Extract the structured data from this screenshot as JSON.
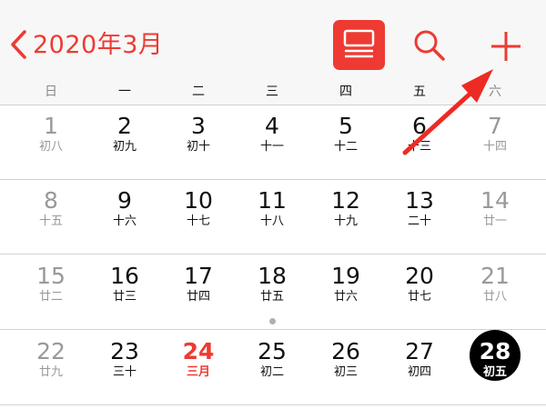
{
  "header": {
    "title": "2020年3月",
    "accent": "#ee3a32"
  },
  "weekdays": [
    "日",
    "一",
    "二",
    "三",
    "四",
    "五",
    "六"
  ],
  "weeks": [
    [
      {
        "num": "1",
        "lunar": "初八"
      },
      {
        "num": "2",
        "lunar": "初九"
      },
      {
        "num": "3",
        "lunar": "初十"
      },
      {
        "num": "4",
        "lunar": "十一"
      },
      {
        "num": "5",
        "lunar": "十二"
      },
      {
        "num": "6",
        "lunar": "十三"
      },
      {
        "num": "7",
        "lunar": "十四"
      }
    ],
    [
      {
        "num": "8",
        "lunar": "十五"
      },
      {
        "num": "9",
        "lunar": "十六"
      },
      {
        "num": "10",
        "lunar": "十七"
      },
      {
        "num": "11",
        "lunar": "十八"
      },
      {
        "num": "12",
        "lunar": "十九"
      },
      {
        "num": "13",
        "lunar": "二十"
      },
      {
        "num": "14",
        "lunar": "廿一"
      }
    ],
    [
      {
        "num": "15",
        "lunar": "廿二"
      },
      {
        "num": "16",
        "lunar": "廿三"
      },
      {
        "num": "17",
        "lunar": "廿四"
      },
      {
        "num": "18",
        "lunar": "廿五"
      },
      {
        "num": "19",
        "lunar": "廿六"
      },
      {
        "num": "20",
        "lunar": "廿七"
      },
      {
        "num": "21",
        "lunar": "廿八"
      }
    ],
    [
      {
        "num": "22",
        "lunar": "廿九"
      },
      {
        "num": "23",
        "lunar": "三十"
      },
      {
        "num": "24",
        "lunar": "三月"
      },
      {
        "num": "25",
        "lunar": "初二"
      },
      {
        "num": "26",
        "lunar": "初三"
      },
      {
        "num": "27",
        "lunar": "初四"
      },
      {
        "num": "28",
        "lunar": "初五"
      }
    ]
  ],
  "today": "24",
  "selected": "28",
  "icons": {
    "back": "chevron-left-icon",
    "list": "list-view-icon",
    "search": "search-icon",
    "add": "plus-icon",
    "annotation": "red-arrow-icon"
  }
}
